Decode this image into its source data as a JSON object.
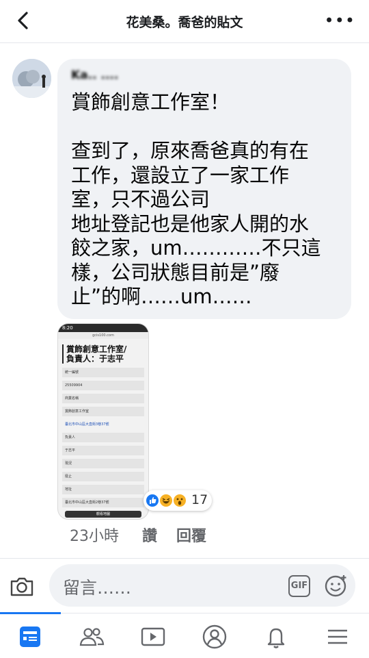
{
  "header": {
    "title": "花美桑。喬爸的貼文",
    "back_icon": "chevron-left-icon",
    "more_icon": "more-dots-icon"
  },
  "comment": {
    "author": "Ka.. ....",
    "text": "賞飾創意工作室！\n\n查到了，原來喬爸真的有在\n工作，還設立了一家工作\n室，只不過公司\n地址登記也是他家人開的水\n餃之家，um…………不只這\n樣，公司狀態目前是”廢\n止”的啊……um……"
  },
  "attachment": {
    "status_time": "8:20",
    "url": "gcis100.com",
    "heading": "賞飾創意工作室/\n負責人：于志平",
    "rows": [
      {
        "label": "統一編號",
        "link": false
      },
      {
        "label": "25509904",
        "link": false
      },
      {
        "label": "商業名稱",
        "link": false
      },
      {
        "label": "賞飾創意工作室",
        "link": false
      },
      {
        "label": "臺北市中山區大直街3巷37號",
        "link": true
      },
      {
        "label": "負責人",
        "link": false
      },
      {
        "label": "于志平",
        "link": false
      },
      {
        "label": "現況",
        "link": false
      },
      {
        "label": "廢止",
        "link": false
      },
      {
        "label": "地址",
        "link": false
      },
      {
        "label": "臺北市中山區大直街2巷37號",
        "link": false
      }
    ],
    "button": "觀看地圖"
  },
  "reactions": {
    "icons": [
      "like-reaction-icon",
      "haha-reaction-icon",
      "wow-reaction-icon"
    ],
    "count": "17"
  },
  "meta": {
    "time": "23小時",
    "like": "讚",
    "reply": "回覆"
  },
  "composer": {
    "placeholder": "留言……",
    "gif_label": "GIF"
  },
  "tabs": [
    {
      "name": "news-feed",
      "icon": "news-feed-icon",
      "active": true
    },
    {
      "name": "friends",
      "icon": "friends-icon",
      "active": false
    },
    {
      "name": "watch",
      "icon": "watch-icon",
      "active": false
    },
    {
      "name": "profile",
      "icon": "profile-icon",
      "active": false
    },
    {
      "name": "notifications",
      "icon": "bell-icon",
      "active": false
    },
    {
      "name": "menu",
      "icon": "menu-icon",
      "active": false
    }
  ],
  "colors": {
    "accent": "#1877f2",
    "bubble": "#f0f2f5",
    "meta_text": "#65676b"
  }
}
